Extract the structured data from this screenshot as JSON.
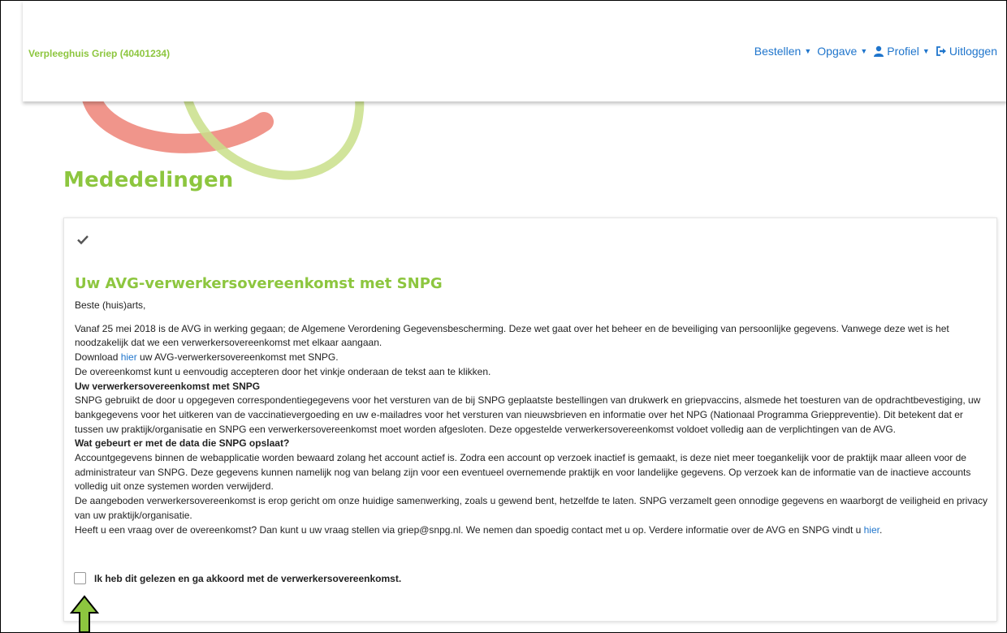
{
  "header": {
    "brand": "Verpleeghuis Griep (40401234)",
    "nav": {
      "bestellen": "Bestellen",
      "opgave": "Opgave",
      "profiel": "Profiel",
      "uitloggen": "Uitloggen"
    }
  },
  "page": {
    "title": "Mededelingen"
  },
  "notice": {
    "title": "Uw AVG-verwerkersovereenkomst met SNPG",
    "greeting": "Beste (huis)arts,",
    "intro": "Vanaf 25 mei 2018 is de AVG in werking gegaan; de Algemene Verordening Gegevensbescherming. Deze wet gaat over het beheer en de beveiliging van persoonlijke gegevens. Vanwege deze wet is het noodzakelijk dat we een verwerkersovereenkomst met elkaar aangaan.",
    "download_prefix": "Download ",
    "download_link": "hier",
    "download_suffix": " uw AVG-verwerkersovereenkomst met SNPG.",
    "accept_hint": "De overeenkomst kunt u eenvoudig accepteren door het vinkje onderaan de tekst aan te klikken.",
    "heading1": "Uw verwerkersovereenkomst met SNPG",
    "para1": "SNPG gebruikt de door u opgegeven correspondentiegegevens voor het versturen van de bij SNPG geplaatste bestellingen van drukwerk en griepvaccins, alsmede het toesturen van de opdrachtbevestiging, uw bankgegevens voor het uitkeren van de vaccinatievergoeding en uw e-mailadres voor het versturen van nieuwsbrieven en informatie over het NPG (Nationaal Programma Grieppreventie). Dit betekent dat er tussen uw praktijk/organisatie en SNPG een verwerkersovereenkomst moet worden afgesloten. Deze opgestelde verwerkersovereenkomst voldoet volledig aan de verplichtingen van de AVG.",
    "heading2": "Wat gebeurt er met de data die SNPG opslaat?",
    "para2": "Accountgegevens binnen de webapplicatie worden bewaard zolang het account actief is. Zodra een account op verzoek inactief is gemaakt, is deze niet meer toegankelijk voor de praktijk maar alleen voor de administrateur van SNPG. Deze gegevens kunnen namelijk nog van belang zijn voor een eventueel overnemende praktijk en voor landelijke gegevens. Op verzoek kan de informatie van de inactieve accounts volledig uit onze systemen worden verwijderd.",
    "para3": "De aangeboden verwerkersovereenkomst is erop gericht om onze huidige samenwerking, zoals u gewend bent, hetzelfde te laten. SNPG verzamelt geen onnodige gegevens en waarborgt de veiligheid en privacy van uw praktijk/organisatie.",
    "contact_prefix": "Heeft u een vraag over de overeenkomst? Dan kunt u uw vraag stellen via griep@snpg.nl. We nemen dan spoedig contact met u op. Verdere informatie over de AVG en SNPG vindt u ",
    "contact_link": "hier",
    "contact_suffix": ".",
    "agree_label": "Ik heb dit gelezen en ga akkoord met de verwerkersovereenkomst.",
    "agree_checked": false
  },
  "colors": {
    "brand_green": "#8dc63f",
    "link_blue": "#1f75cc",
    "deco_red": "#ec7a6e",
    "deco_green": "#c9df8a"
  },
  "icons": {
    "check": "check-icon",
    "user": "user-icon",
    "logout": "sign-out-icon",
    "caret": "caret-down-icon",
    "annotation": "up-arrow-icon"
  }
}
